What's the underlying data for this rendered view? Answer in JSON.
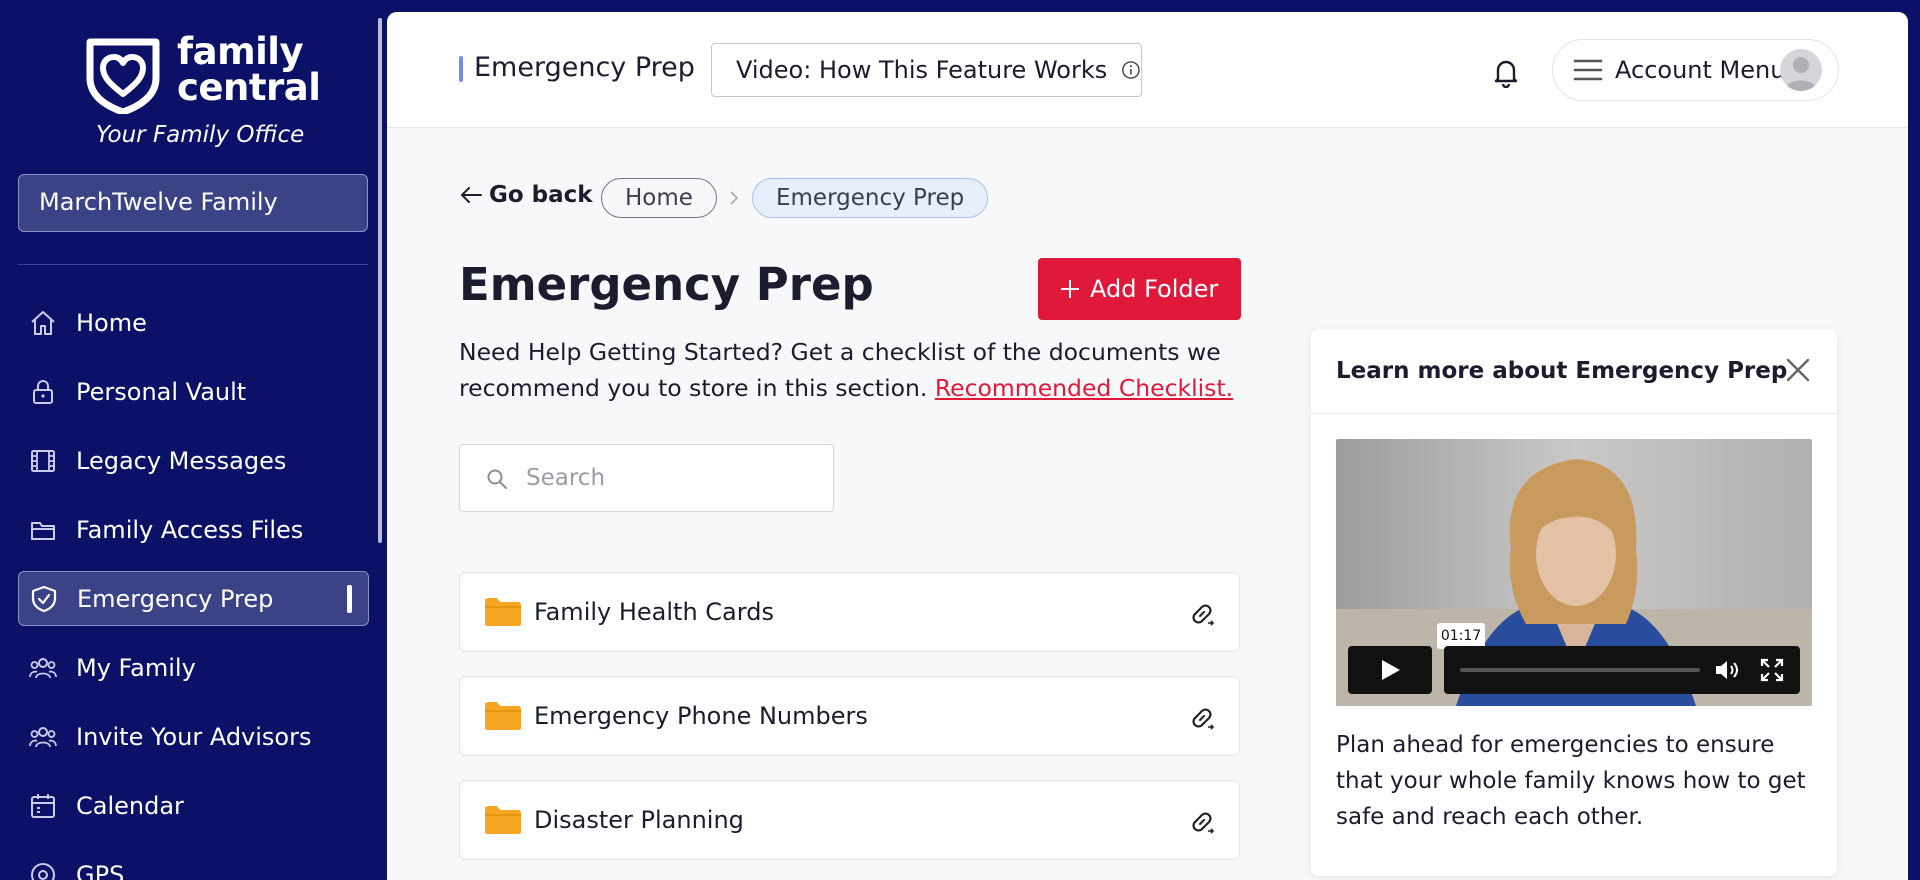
{
  "brand": {
    "wordmark_line1": "family",
    "wordmark_line2": "central",
    "tagline": "Your Family Office"
  },
  "family_selector": {
    "value": "MarchTwelve Family"
  },
  "sidebar": {
    "items": [
      {
        "label": "Home",
        "icon": "home-icon"
      },
      {
        "label": "Personal Vault",
        "icon": "lock-icon"
      },
      {
        "label": "Legacy Messages",
        "icon": "film-icon"
      },
      {
        "label": "Family Access Files",
        "icon": "folder-icon"
      },
      {
        "label": "Emergency Prep",
        "icon": "shield-check-icon",
        "active": true
      },
      {
        "label": "My Family",
        "icon": "people-icon"
      },
      {
        "label": "Invite Your Advisors",
        "icon": "people-icon"
      },
      {
        "label": "Calendar",
        "icon": "calendar-icon"
      },
      {
        "label": "GPS",
        "icon": "location-pin-icon"
      }
    ]
  },
  "header": {
    "title": "Emergency Prep",
    "video_button": "Video: How This Feature Works",
    "account_menu": "Account Menu"
  },
  "breadcrumb": {
    "back": "Go back",
    "items": [
      "Home",
      "Emergency Prep"
    ]
  },
  "page": {
    "title": "Emergency Prep",
    "add_folder": "Add Folder",
    "help_text": "Need Help Getting Started? Get a checklist of the documents we recommend you to store in this section.",
    "help_link": "Recommended Checklist.",
    "search_placeholder": "Search"
  },
  "folders": [
    {
      "name": "Family Health Cards"
    },
    {
      "name": "Emergency Phone Numbers"
    },
    {
      "name": "Disaster Planning"
    }
  ],
  "learn_more": {
    "title": "Learn more about Emergency Prep",
    "video_time": "01:17",
    "description": "Plan ahead for emergencies to ensure that your whole family knows how to get safe and reach each other."
  },
  "colors": {
    "sidebar_bg": "#0a1166",
    "accent_red": "#e0193b",
    "active_item_bg": "#3a4386",
    "folder_yellow": "#f5a623"
  }
}
